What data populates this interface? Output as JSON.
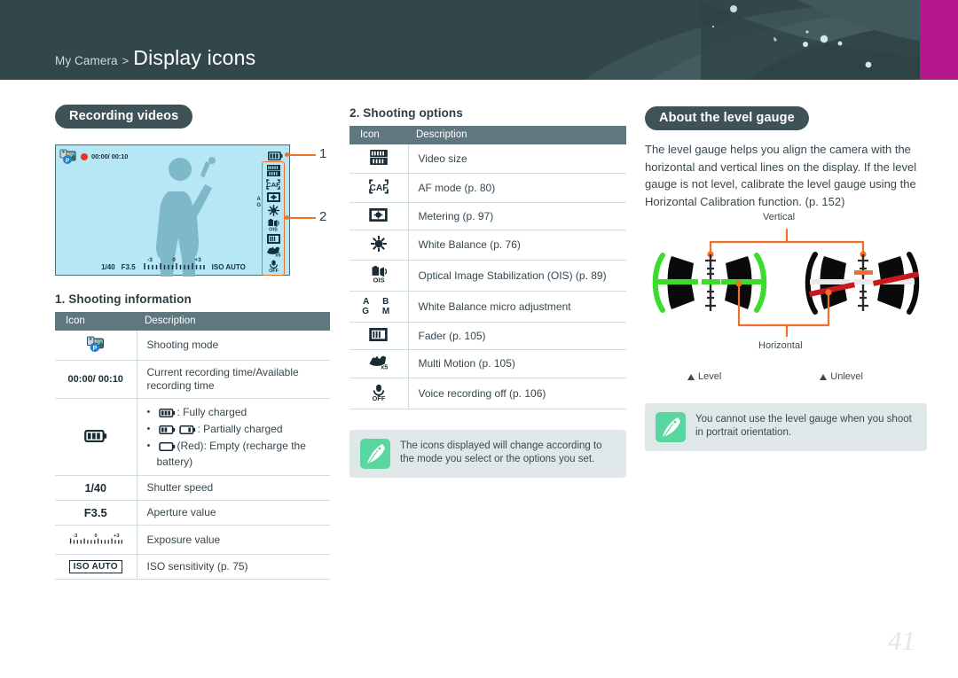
{
  "header": {
    "breadcrumb_parent": "My Camera",
    "breadcrumb_separator": ">",
    "title": "Display icons",
    "bar_color": "#33474a",
    "accent_tab_color": "#b5188c"
  },
  "page_number": "41",
  "col_left": {
    "badge": "Recording videos",
    "camera_preview": {
      "recording_time": "00:00/ 00:10",
      "shutter_speed": "1/40",
      "aperture": "F3.5",
      "ev_minus": "-3",
      "ev_zero": "0",
      "ev_plus": "+3",
      "iso": "ISO AUTO",
      "callout_1": "1",
      "callout_2": "2",
      "wb_micro": [
        "A",
        "B",
        "G",
        ""
      ],
      "rail_icons": [
        "video-size-icon",
        "af-mode-icon",
        "metering-icon",
        "white-balance-icon",
        "ois-icon",
        "fader-icon",
        "multi-motion-icon",
        "voice-off-icon"
      ]
    },
    "table_title": "1. Shooting information",
    "table_headers": [
      "Icon",
      "Description"
    ],
    "rows": [
      {
        "icon_kind": "shooting-mode",
        "icon_text": "",
        "desc": "Shooting mode"
      },
      {
        "icon_kind": "text",
        "icon_text": "00:00/ 00:10",
        "desc": "Current recording time/Available recording time"
      },
      {
        "icon_kind": "battery",
        "icon_text": "",
        "desc": "",
        "bullets": [
          {
            "pre": "",
            "icon": "battery-full",
            "text": ": Fully charged"
          },
          {
            "pre": "",
            "icon": "battery-partial",
            "text": ": Partially charged"
          },
          {
            "pre": "",
            "icon": "battery-empty",
            "text": "(Red): Empty (recharge the battery)"
          }
        ]
      },
      {
        "icon_kind": "text",
        "icon_text": "1/40",
        "desc": "Shutter speed"
      },
      {
        "icon_kind": "text",
        "icon_text": "F3.5",
        "desc": "Aperture value"
      },
      {
        "icon_kind": "exposure",
        "icon_text": "",
        "desc": "Exposure value"
      },
      {
        "icon_kind": "iso",
        "icon_text": "ISO AUTO",
        "desc": "ISO sensitivity (p. 75)"
      }
    ]
  },
  "col_mid": {
    "table_title": "2. Shooting options",
    "table_headers": [
      "Icon",
      "Description"
    ],
    "rows": [
      {
        "icon_kind": "video-size",
        "desc": "Video size"
      },
      {
        "icon_kind": "af-mode",
        "desc": "AF mode (p. 80)"
      },
      {
        "icon_kind": "metering",
        "desc": "Metering (p. 97)"
      },
      {
        "icon_kind": "white-balance",
        "desc": "White Balance (p. 76)"
      },
      {
        "icon_kind": "ois",
        "desc": "Optical Image Stabilization (OIS) (p. 89)"
      },
      {
        "icon_kind": "wb-micro",
        "desc": "White Balance micro adjustment"
      },
      {
        "icon_kind": "fader",
        "desc": "Fader (p. 105)"
      },
      {
        "icon_kind": "multi-motion",
        "desc": "Multi Motion (p. 105)"
      },
      {
        "icon_kind": "voice-off",
        "desc": "Voice recording off (p. 106)"
      }
    ],
    "note": "The icons displayed will change according to the mode you select or the options you set."
  },
  "col_right": {
    "badge": "About the level gauge",
    "body": "The level gauge helps you align the camera with the horizontal and vertical lines on the display. If the level gauge is not level, calibrate the level gauge using the Horizontal Calibration function. (p. 152)",
    "gauge": {
      "label_vertical": "Vertical",
      "label_horizontal": "Horizontal",
      "caption_level": "Level",
      "caption_unlevel": "Unlevel",
      "level_color": "#3ddc2b",
      "unlevel_color": "#c8171e",
      "connector_color": "#f0702a"
    },
    "note": "You cannot use the level gauge when you shoot in portrait orientation."
  }
}
